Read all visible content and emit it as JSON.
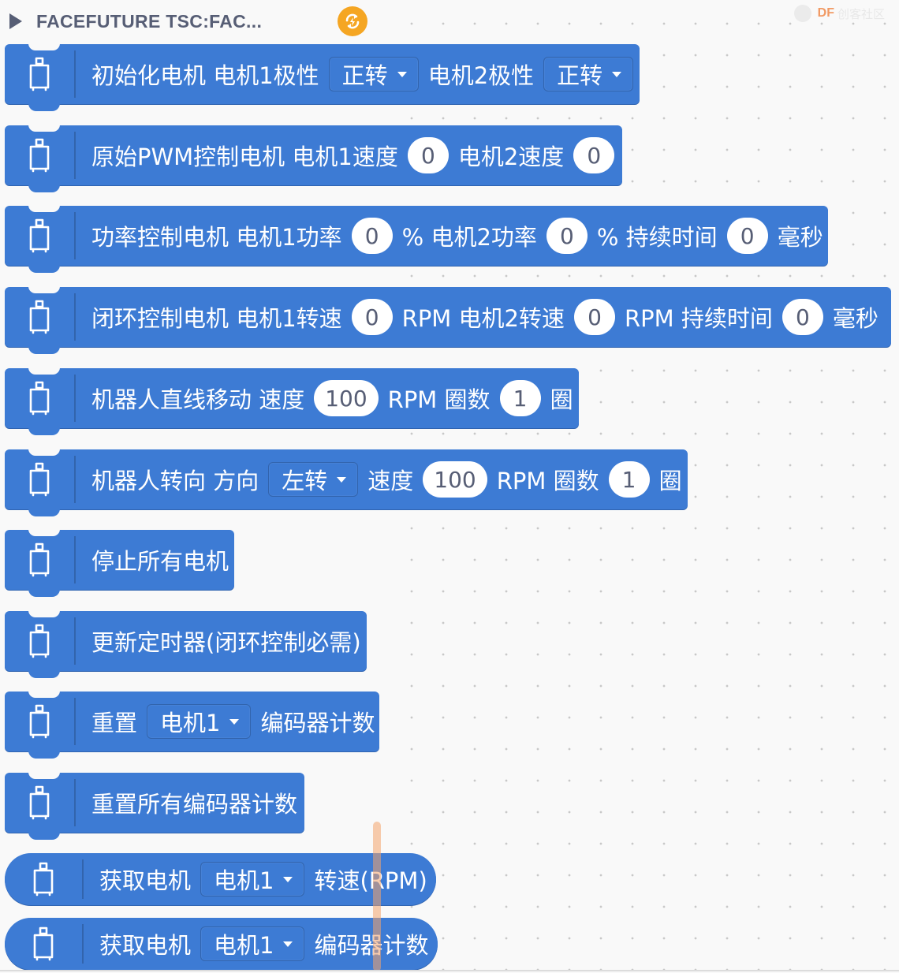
{
  "category": {
    "title": "FACEFUTURE TSC:FAC...",
    "expand_icon": "triangle-right-icon",
    "status_icon": "refresh-icon",
    "accent": "#f5a623"
  },
  "logo": {
    "text": "DF",
    "subtitle": "创客社区"
  },
  "block_color": "#3d7bd4",
  "blocks": {
    "init": {
      "t1": "初始化电机 电机1极性",
      "dd1": "正转",
      "t2": "电机2极性",
      "dd2": "正转"
    },
    "pwm": {
      "t1": "原始PWM控制电机 电机1速度",
      "v1": "0",
      "t2": "电机2速度",
      "v2": "0"
    },
    "power": {
      "t1": "功率控制电机 电机1功率",
      "v1": "0",
      "t2": "% 电机2功率",
      "v2": "0",
      "t3": "% 持续时间",
      "v3": "0",
      "t4": "毫秒"
    },
    "closed": {
      "t1": "闭环控制电机 电机1转速",
      "v1": "0",
      "t2": "RPM 电机2转速",
      "v2": "0",
      "t3": "RPM 持续时间",
      "v3": "0",
      "t4": "毫秒"
    },
    "straight": {
      "t1": "机器人直线移动 速度",
      "v1": "100",
      "t2": "RPM 圈数",
      "v2": "1",
      "t3": "圈"
    },
    "turn": {
      "t1": "机器人转向 方向",
      "dd1": "左转",
      "t2": "速度",
      "v1": "100",
      "t3": "RPM 圈数",
      "v2": "1",
      "t4": "圈"
    },
    "stop": {
      "t1": "停止所有电机"
    },
    "timer": {
      "t1": "更新定时器(闭环控制必需)"
    },
    "reset_one": {
      "t1": "重置",
      "dd1": "电机1",
      "t2": "编码器计数"
    },
    "reset_all": {
      "t1": "重置所有编码器计数"
    },
    "get_rpm": {
      "t1": "获取电机",
      "dd1": "电机1",
      "t2": "转速(RPM)"
    },
    "get_enc": {
      "t1": "获取电机",
      "dd1": "电机1",
      "t2": "编码器计数"
    }
  }
}
